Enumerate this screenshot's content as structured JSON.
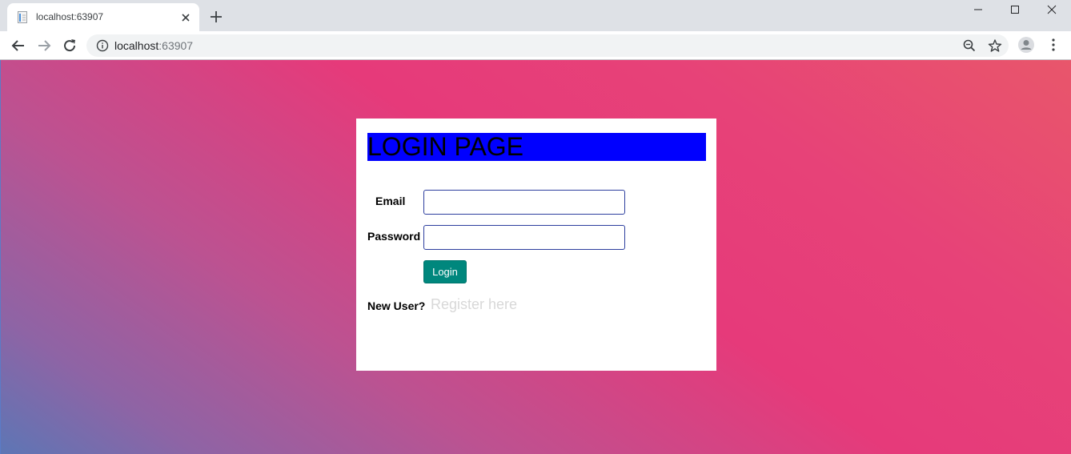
{
  "browser": {
    "tab": {
      "title": "localhost:63907"
    },
    "address_bar": {
      "host": "localhost",
      "port": ":63907"
    },
    "icons": {
      "favicon": "page-icon",
      "tab_close": "close-icon",
      "new_tab": "plus-icon",
      "back": "arrow-left-icon",
      "forward": "arrow-right-icon",
      "reload": "reload-icon",
      "site_info": "info-icon",
      "zoom": "zoom-out-icon",
      "bookmark": "star-icon",
      "profile": "avatar-icon",
      "menu": "kebab-menu-icon"
    }
  },
  "page": {
    "background_colors": [
      "#5d76b5",
      "#bc5291",
      "#e63a7a",
      "#e8566b"
    ],
    "login": {
      "title": "LOGIN PAGE",
      "header_color": "#0000ff",
      "email_label": "Email",
      "email_value": "",
      "password_label": "Password",
      "password_value": "",
      "login_button": "Login",
      "login_button_color": "#00877d",
      "new_user_label": "New User?",
      "register_link": "Register here"
    }
  }
}
